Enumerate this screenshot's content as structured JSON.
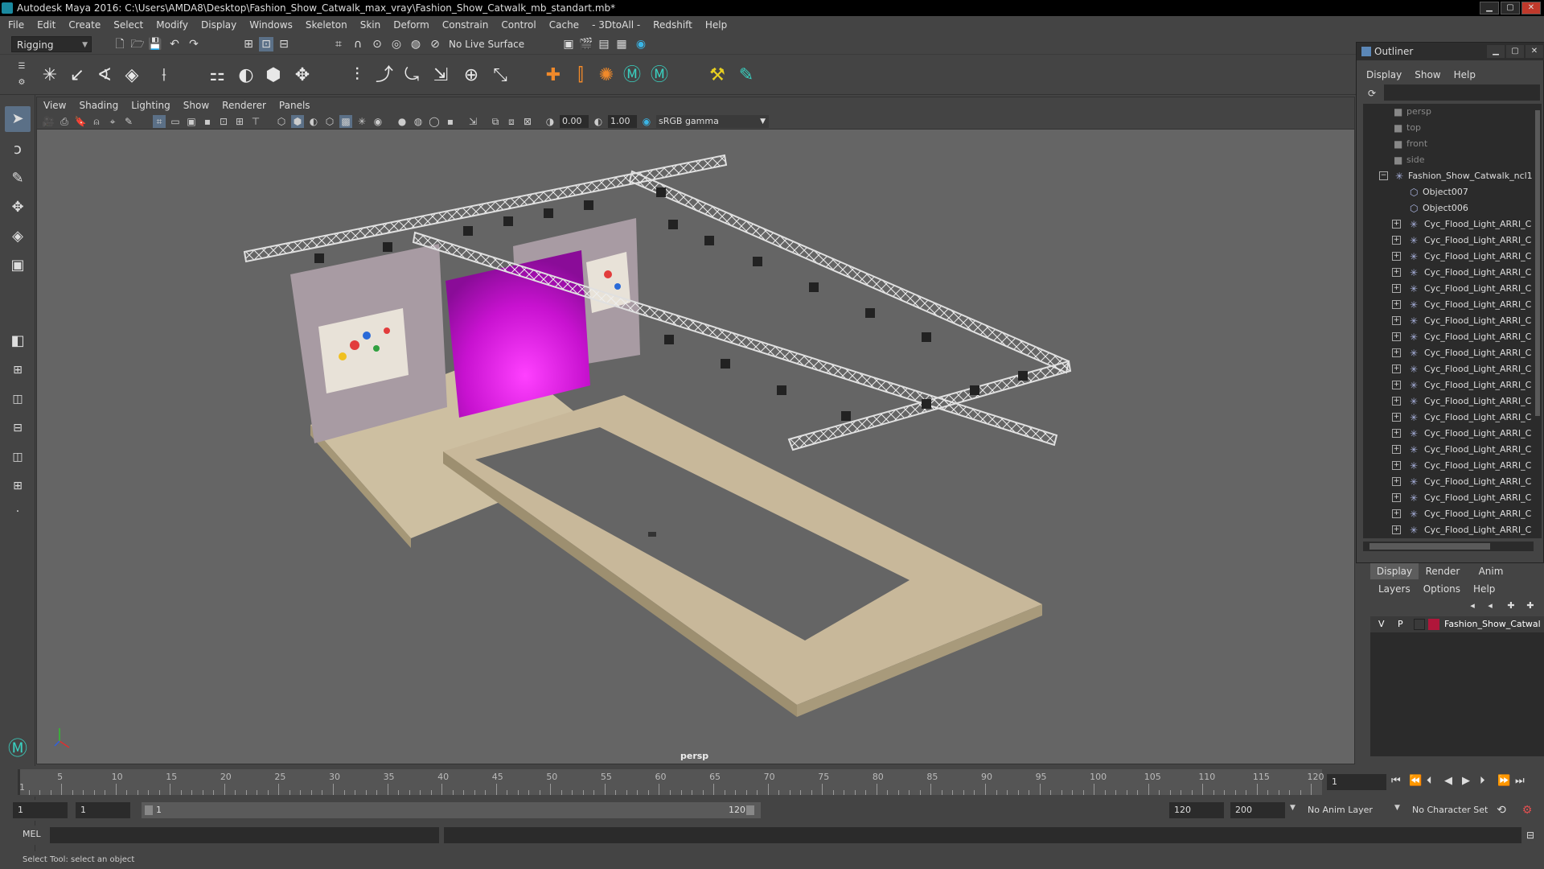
{
  "window": {
    "title": "Autodesk Maya 2016: C:\\Users\\AMDA8\\Desktop\\Fashion_Show_Catwalk_max_vray\\Fashion_Show_Catwalk_mb_standart.mb*"
  },
  "menubar": [
    "File",
    "Edit",
    "Create",
    "Select",
    "Modify",
    "Display",
    "Windows",
    "Skeleton",
    "Skin",
    "Deform",
    "Constrain",
    "Control",
    "Cache",
    "- 3DtoAll -",
    "Redshift",
    "Help"
  ],
  "status": {
    "menuset": "Rigging",
    "live_surface": "No Live Surface"
  },
  "viewport": {
    "menus": [
      "View",
      "Shading",
      "Lighting",
      "Show",
      "Renderer",
      "Panels"
    ],
    "exposure": "0.00",
    "gamma": "1.00",
    "colorspace": "sRGB gamma",
    "camera_label": "persp"
  },
  "outliner": {
    "title": "Outliner",
    "menus": [
      "Display",
      "Show",
      "Help"
    ],
    "cameras": [
      "persp",
      "top",
      "front",
      "side"
    ],
    "root": "Fashion_Show_Catwalk_ncl1",
    "objects": [
      "Object007",
      "Object006"
    ],
    "light_label": "Cyc_Flood_Light_ARRI_C",
    "light_count": 20
  },
  "layers": {
    "tabs": [
      "Display",
      "Render",
      "Anim"
    ],
    "menus": [
      "Layers",
      "Options",
      "Help"
    ],
    "layer": {
      "v": "V",
      "p": "P",
      "name": "Fashion_Show_Catwal",
      "color": "#b0163a"
    }
  },
  "timeline": {
    "ticks": [
      "5",
      "10",
      "15",
      "20",
      "25",
      "30",
      "35",
      "40",
      "45",
      "50",
      "55",
      "60",
      "65",
      "70",
      "75",
      "80",
      "85",
      "90",
      "95",
      "100",
      "105",
      "110",
      "115",
      "120"
    ],
    "start_mark": "1",
    "current_frame": "1"
  },
  "range": {
    "start": "1",
    "playback_start": "1",
    "slider_start": "1",
    "slider_end": "120",
    "playback_end": "120",
    "end": "200",
    "anim_layer": "No Anim Layer",
    "char_set": "No Character Set"
  },
  "cmd": {
    "lang": "MEL"
  },
  "help": "Select Tool: select an object",
  "colors": {
    "accent": "#5b7087",
    "stage": "#c8b89a",
    "panel_purple": "#d21ad8"
  }
}
